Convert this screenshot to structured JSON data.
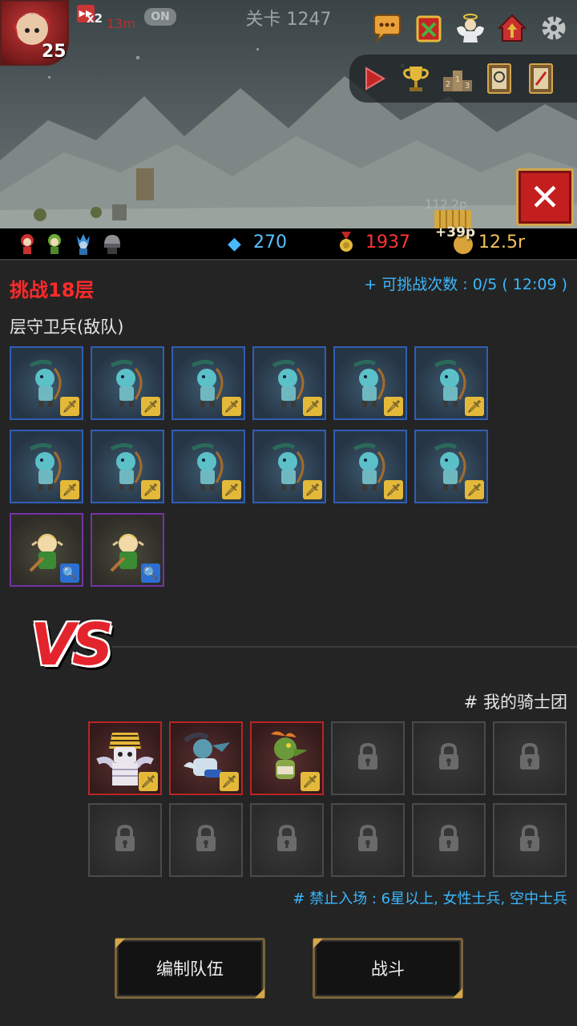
{
  "hud": {
    "player_level": "25",
    "speed_multiplier": "x2",
    "speed_timer": "13m",
    "auto_toggle": "ON",
    "stage_label": "关卡 1247",
    "floating_text": "112.2p",
    "gold_gain": "+39p"
  },
  "top_icons": [
    "chat-icon",
    "shield-event-icon",
    "angel-icon",
    "house-icon",
    "gear-icon"
  ],
  "tool_icons": [
    "play-icon",
    "trophy-icon",
    "ranking-podium-icon",
    "quest-book-icon",
    "document-icon"
  ],
  "resources": {
    "gems": "270",
    "medals": "1937",
    "gold": "12.5r"
  },
  "party_icons": [
    "red-hero-icon",
    "green-hero-icon",
    "blue-knight-icon",
    "helmet-icon"
  ],
  "challenge": {
    "floor_title": "挑战18层",
    "attempts_text": "+ 可挑战次数 : 0/5 ( 12:09 )",
    "guard_label": "层守卫兵(敌队)"
  },
  "enemies": [
    {
      "type": "archer",
      "class": "sword"
    },
    {
      "type": "archer",
      "class": "sword"
    },
    {
      "type": "archer",
      "class": "sword"
    },
    {
      "type": "archer",
      "class": "sword"
    },
    {
      "type": "archer",
      "class": "sword"
    },
    {
      "type": "archer",
      "class": "sword"
    },
    {
      "type": "archer",
      "class": "sword"
    },
    {
      "type": "archer",
      "class": "sword"
    },
    {
      "type": "archer",
      "class": "sword"
    },
    {
      "type": "archer",
      "class": "sword"
    },
    {
      "type": "archer",
      "class": "sword"
    },
    {
      "type": "archer",
      "class": "sword"
    },
    {
      "type": "elf-mage",
      "class": "staff"
    },
    {
      "type": "elf-mage",
      "class": "staff"
    }
  ],
  "vs_label": "VS",
  "my_team": {
    "label": "# 我的骑士团",
    "members": [
      "mummy-pharaoh",
      "blue-dragon-rider",
      "orange-lizard"
    ],
    "locked_slots": 9,
    "ban_text": "# 禁止入场 : 6星以上, 女性士兵, 空中士兵"
  },
  "buttons": {
    "edit_team": "编制队伍",
    "battle": "战斗"
  },
  "colors": {
    "floor_title": "#ff2a2a",
    "info_blue": "#3bb8ff",
    "enemy_border_blue": "#2f5eb5",
    "enemy_border_purple": "#7433a6",
    "ally_border_red": "#b92525",
    "close_red": "#c31f1f"
  }
}
